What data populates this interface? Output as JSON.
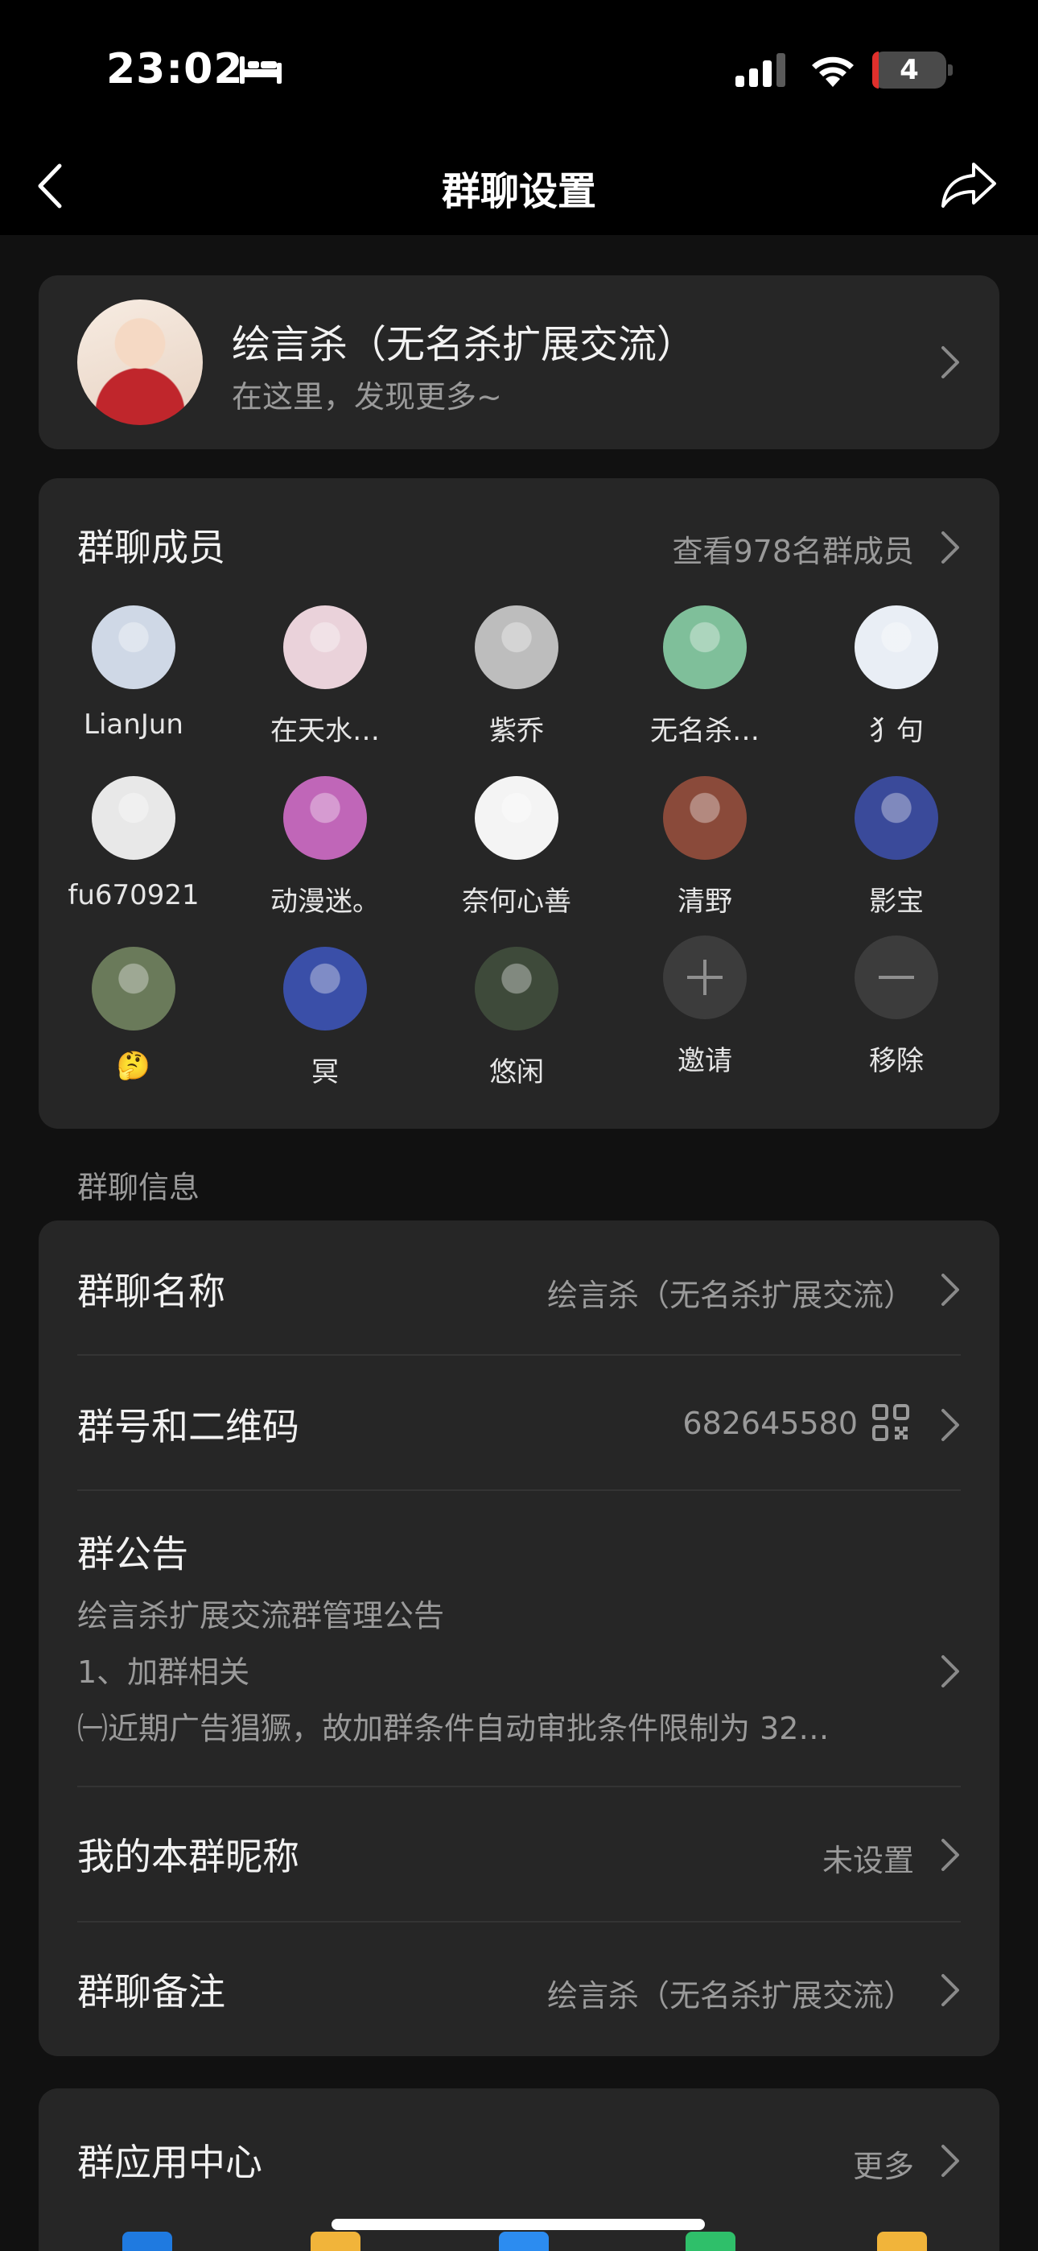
{
  "status_bar": {
    "time": "23:02",
    "battery": "4"
  },
  "nav": {
    "title": "群聊设置"
  },
  "group": {
    "name": "绘言杀（无名杀扩展交流）",
    "subtitle": "在这里，发现更多~"
  },
  "members": {
    "title": "群聊成员",
    "view_all": "查看978名群成员",
    "list": [
      {
        "name": "LianJun",
        "avatar": "#cfd8e6"
      },
      {
        "name": "在天水…",
        "avatar": "#ead2da"
      },
      {
        "name": "紫乔",
        "avatar": "#bdbdbd"
      },
      {
        "name": "无名杀…",
        "avatar": "#7fbf9a"
      },
      {
        "name": "犭句",
        "avatar": "#e9eef5"
      },
      {
        "name": "fu670921",
        "avatar": "#e8e8e8"
      },
      {
        "name": "动漫迷。",
        "avatar": "#c066b8"
      },
      {
        "name": "奈何心善",
        "avatar": "#f4f4f4"
      },
      {
        "name": "清野",
        "avatar": "#8a4a3a"
      },
      {
        "name": "影宝",
        "avatar": "#3a4a9a"
      },
      {
        "name": "🤔",
        "avatar": "#6a7a5a"
      },
      {
        "name": "冥",
        "avatar": "#3a4fa8"
      },
      {
        "name": "悠闲",
        "avatar": "#3e4a3a"
      }
    ],
    "invite_label": "邀请",
    "remove_label": "移除"
  },
  "info": {
    "section_label": "群聊信息",
    "group_name_label": "群聊名称",
    "group_name_value": "绘言杀（无名杀扩展交流）",
    "group_id_label": "群号和二维码",
    "group_id_value": "682645580",
    "notice_label": "群公告",
    "notice_line1": "绘言杀扩展交流群管理公告",
    "notice_line2": "1、加群相关",
    "notice_line3": "㈠近期广告猖獗，故加群条件自动审批条件限制为 32…",
    "nickname_label": "我的本群昵称",
    "nickname_value": "未设置",
    "remark_label": "群聊备注",
    "remark_value": "绘言杀（无名杀扩展交流）"
  },
  "apps": {
    "title": "群应用中心",
    "more": "更多"
  },
  "colors": {
    "background": "#111111",
    "card": "#262626",
    "secondary_text": "#9a9a9a",
    "accent_red": "#e0302c"
  },
  "icons": [
    "bed-icon",
    "signal-icon",
    "wifi-icon",
    "back-icon",
    "share-icon",
    "chevron-right-icon",
    "qr-code-icon",
    "plus-icon",
    "minus-icon"
  ]
}
